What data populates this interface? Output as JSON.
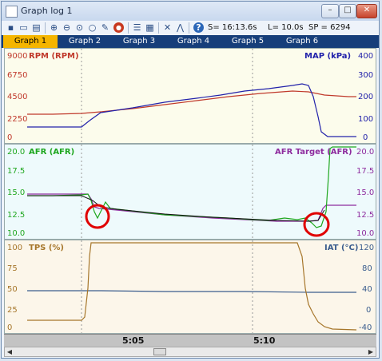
{
  "window": {
    "title": "Graph log 1",
    "minimize": "–",
    "maximize": "□",
    "close": "✕"
  },
  "toolbar": {
    "icons": [
      "save-icon",
      "open-icon",
      "export-icon",
      "zoom-in-icon",
      "zoom-out-icon",
      "zoom-fit-icon",
      "zoom-icon",
      "draw-icon",
      "stop-icon",
      "list-icon",
      "properties-icon",
      "tools-icon",
      "chart-icon",
      "help-icon"
    ],
    "status_s": "S= 16:13.6s",
    "status_l": "L= 10.0s",
    "status_sp": "SP = 6294"
  },
  "tabs": [
    "Graph 1",
    "Graph 2",
    "Graph 3",
    "Graph 4",
    "Graph 5",
    "Graph 6"
  ],
  "active_tab": 0,
  "colors": {
    "rpm": "#c0392b",
    "map": "#2222aa",
    "afr": "#1fa71f",
    "afr_target": "#8e2c9e",
    "tps": "#a6762a",
    "iat": "#3b5d8e",
    "highlight": "#e00000"
  },
  "panels": {
    "p1": {
      "left_title": "RPM (RPM)",
      "right_title": "MAP (kPa)",
      "left_ticks": [
        "9000",
        "6750",
        "4500",
        "2250",
        "0"
      ],
      "right_ticks": [
        "400",
        "300",
        "200",
        "100",
        "0"
      ]
    },
    "p2": {
      "left_title": "AFR (AFR)",
      "right_title": "AFR Target (AFR)",
      "left_ticks": [
        "20.0",
        "17.5",
        "15.0",
        "12.5",
        "10.0"
      ],
      "right_ticks": [
        "20.0",
        "17.5",
        "15.0",
        "12.5",
        "10.0"
      ]
    },
    "p3": {
      "left_title": "TPS (%)",
      "right_title": "IAT (°C)",
      "left_ticks": [
        "100",
        "75",
        "50",
        "25",
        "0"
      ],
      "right_ticks": [
        "120",
        "80",
        "40",
        "0",
        "-40"
      ]
    }
  },
  "time_labels": [
    "5:05",
    "5:10"
  ],
  "scrollbar": {
    "left": "◀",
    "right": "▶"
  }
}
